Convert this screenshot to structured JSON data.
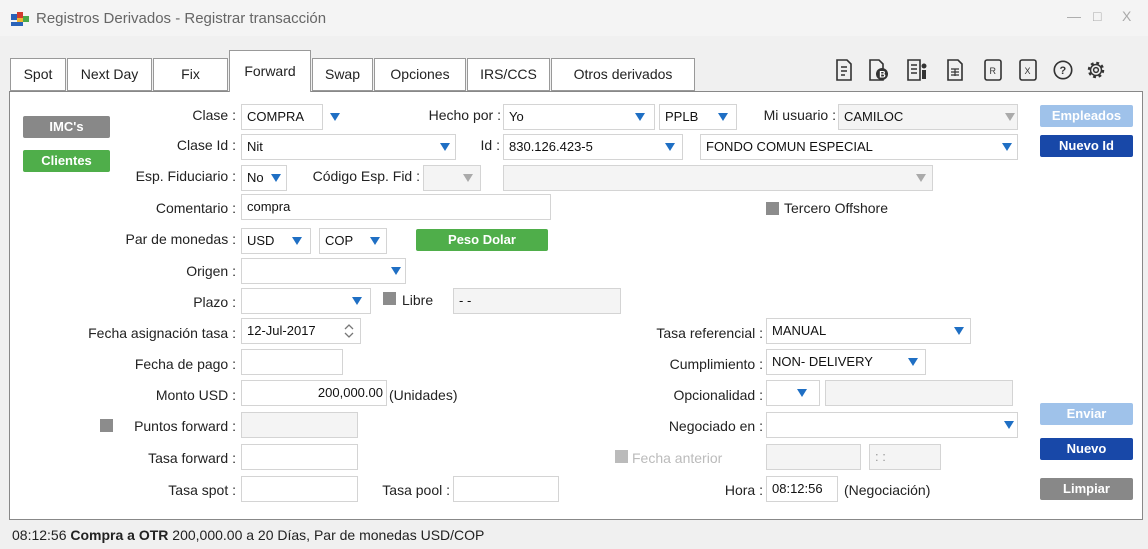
{
  "window": {
    "title": "Registros Derivados - Registrar transacción",
    "minimize": "—",
    "maximize": "□",
    "close": "X"
  },
  "tabs": [
    "Spot",
    "Next Day",
    "Fix",
    "Forward",
    "Swap",
    "Opciones",
    "IRS/CCS",
    "Otros derivados"
  ],
  "active_tab": "Forward",
  "toolbar_icons": [
    "export-icon",
    "database-icon",
    "document-list-icon",
    "spreadsheet-icon",
    "report-icon",
    "excel-icon",
    "help-icon",
    "settings-icon"
  ],
  "buttons": {
    "imcs": "IMC's",
    "clientes": "Clientes",
    "empleados": "Empleados",
    "nuevo_id": "Nuevo Id",
    "peso_dolar": "Peso Dolar",
    "enviar": "Enviar",
    "nuevo": "Nuevo",
    "limpiar": "Limpiar"
  },
  "labels": {
    "clase": "Clase :",
    "hecho_por": "Hecho por :",
    "mi_usuario": "Mi usuario :",
    "clase_id": "Clase Id :",
    "id": "Id :",
    "esp_fiduciario": "Esp. Fiduciario :",
    "codigo_esp_fid": "Código Esp. Fid :",
    "comentario": "Comentario :",
    "tercero_offshore": "Tercero Offshore",
    "par_de_monedas": "Par de monedas :",
    "origen": "Origen :",
    "plazo": "Plazo :",
    "libre": "Libre",
    "fecha_asignacion_tasa": "Fecha asignación tasa :",
    "tasa_referencial": "Tasa referencial :",
    "fecha_de_pago": "Fecha de pago :",
    "cumplimiento": "Cumplimiento :",
    "monto_usd": "Monto USD :",
    "unidades": "(Unidades)",
    "opcionalidad": "Opcionalidad :",
    "puntos_forward": "Puntos forward :",
    "negociado_en": "Negociado en :",
    "tasa_forward": "Tasa forward :",
    "fecha_anterior": "Fecha anterior",
    "tasa_spot": "Tasa spot :",
    "tasa_pool": "Tasa pool :",
    "hora": "Hora :",
    "negociacion": "(Negociación)"
  },
  "values": {
    "clase": "COMPRA",
    "hecho_por": "Yo",
    "pplb": "PPLB",
    "mi_usuario": "CAMILOC",
    "clase_id": "Nit",
    "id": "830.126.423-5",
    "fondo": "FONDO COMUN ESPECIAL",
    "esp_fiduciario": "No",
    "codigo_esp_fid": "",
    "comentario": "compra",
    "moneda1": "USD",
    "moneda2": "COP",
    "origen": "",
    "plazo": "",
    "libre_value": "-  -",
    "fecha_asignacion_tasa": "12-Jul-2017",
    "tasa_referencial": "MANUAL",
    "fecha_de_pago": "",
    "cumplimiento": "NON- DELIVERY",
    "monto_usd": "200,000.00",
    "opcionalidad": "",
    "puntos_forward": "",
    "negociado_en": "",
    "tasa_forward": "",
    "fecha_anterior_time": ": :",
    "tasa_spot": "",
    "tasa_pool": "",
    "hora": "08:12:56"
  },
  "status": {
    "time": "08:12:56",
    "bold": "Compra a  OTR",
    "rest": "200,000.00 a 20 Días, Par de monedas USD/COP"
  },
  "colors": {
    "accent_blue": "#1f6fc4",
    "button_blue": "#1848a8",
    "button_green": "#4fae4a",
    "button_grey": "#888888",
    "button_disabled": "#9fc2ea"
  }
}
